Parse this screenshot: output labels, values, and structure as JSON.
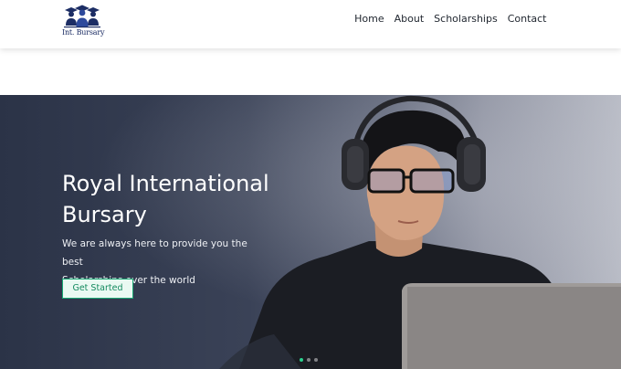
{
  "brand": {
    "logo_text": "Int. Bursary",
    "logo_color": "#1c2d64"
  },
  "nav": {
    "items": [
      "Home",
      "About",
      "Scholarships",
      "Contact"
    ]
  },
  "hero": {
    "title_line1": "Royal International",
    "title_line2": "Bursary",
    "subtitle_line1": "We are always here to provide you the best",
    "subtitle_line2": "Scholarships over the world",
    "cta_label": "Get Started",
    "accent_color": "#19a974",
    "slide_count": 3,
    "active_slide": 1
  },
  "icons": {
    "logo": "students-graduation-icon",
    "carousel": "carousel-dot-icon"
  }
}
